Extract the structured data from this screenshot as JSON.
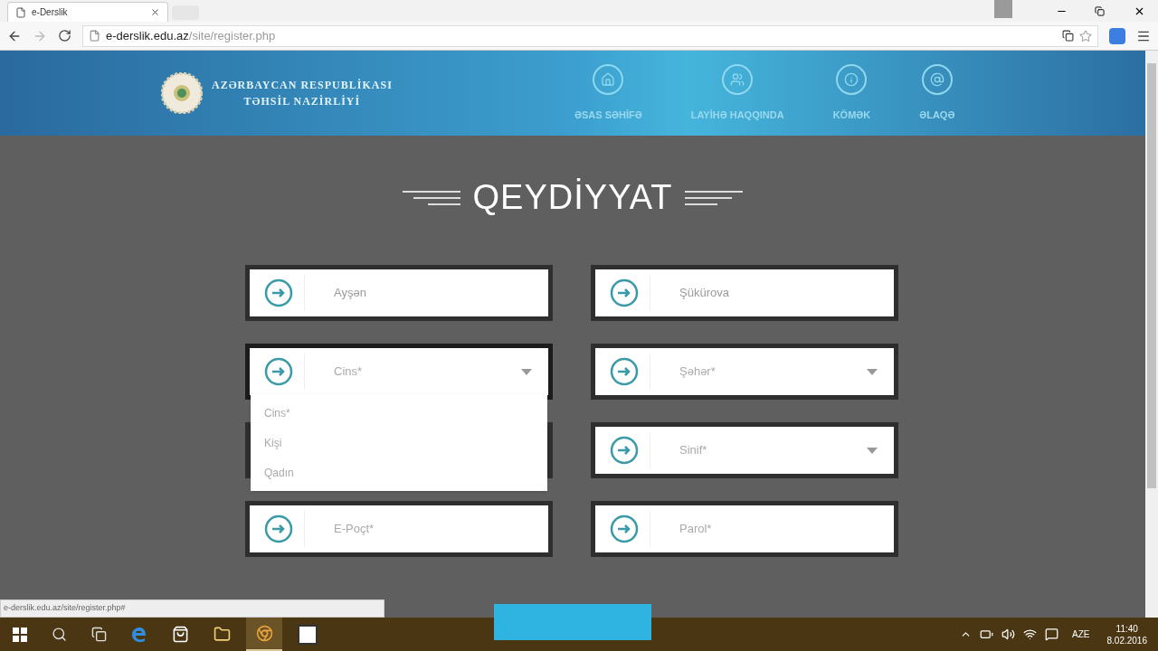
{
  "browser": {
    "tab_title": "e-Derslik",
    "url_host": "e-derslik.edu.az",
    "url_path": "/site/register.php",
    "status_url": "e-derslik.edu.az/site/register.php#"
  },
  "header": {
    "logo_line_1": "AZƏRBAYCAN RESPUBLİKASI",
    "logo_line_2": "TƏHSİL NAZİRLİYİ",
    "nav": [
      {
        "label": "ƏSAS SƏHİFƏ",
        "kind": "home"
      },
      {
        "label": "LAYİHƏ HAQQINDA",
        "kind": "project"
      },
      {
        "label": "KÖMƏK",
        "kind": "info"
      },
      {
        "label": "ƏLAQƏ",
        "kind": "contact"
      }
    ]
  },
  "form": {
    "title": "QEYDİYYAT",
    "fields": [
      {
        "kind": "text",
        "value": "Ayşən"
      },
      {
        "kind": "text",
        "value": "Şükürova"
      },
      {
        "kind": "select",
        "placeholder": "Cins*",
        "expanded": true,
        "options": [
          "Cins*",
          "Kişi",
          "Qadın"
        ]
      },
      {
        "kind": "select",
        "placeholder": "Şəhər*",
        "expanded": false
      },
      {
        "kind": "covered"
      },
      {
        "kind": "select",
        "placeholder": "Sinif*",
        "expanded": false
      },
      {
        "kind": "text",
        "placeholder": "E-Poçt*"
      },
      {
        "kind": "text",
        "placeholder": "Parol*"
      }
    ]
  },
  "taskbar": {
    "language": "AZE",
    "time": "11:40",
    "date": "8.02.2016"
  }
}
